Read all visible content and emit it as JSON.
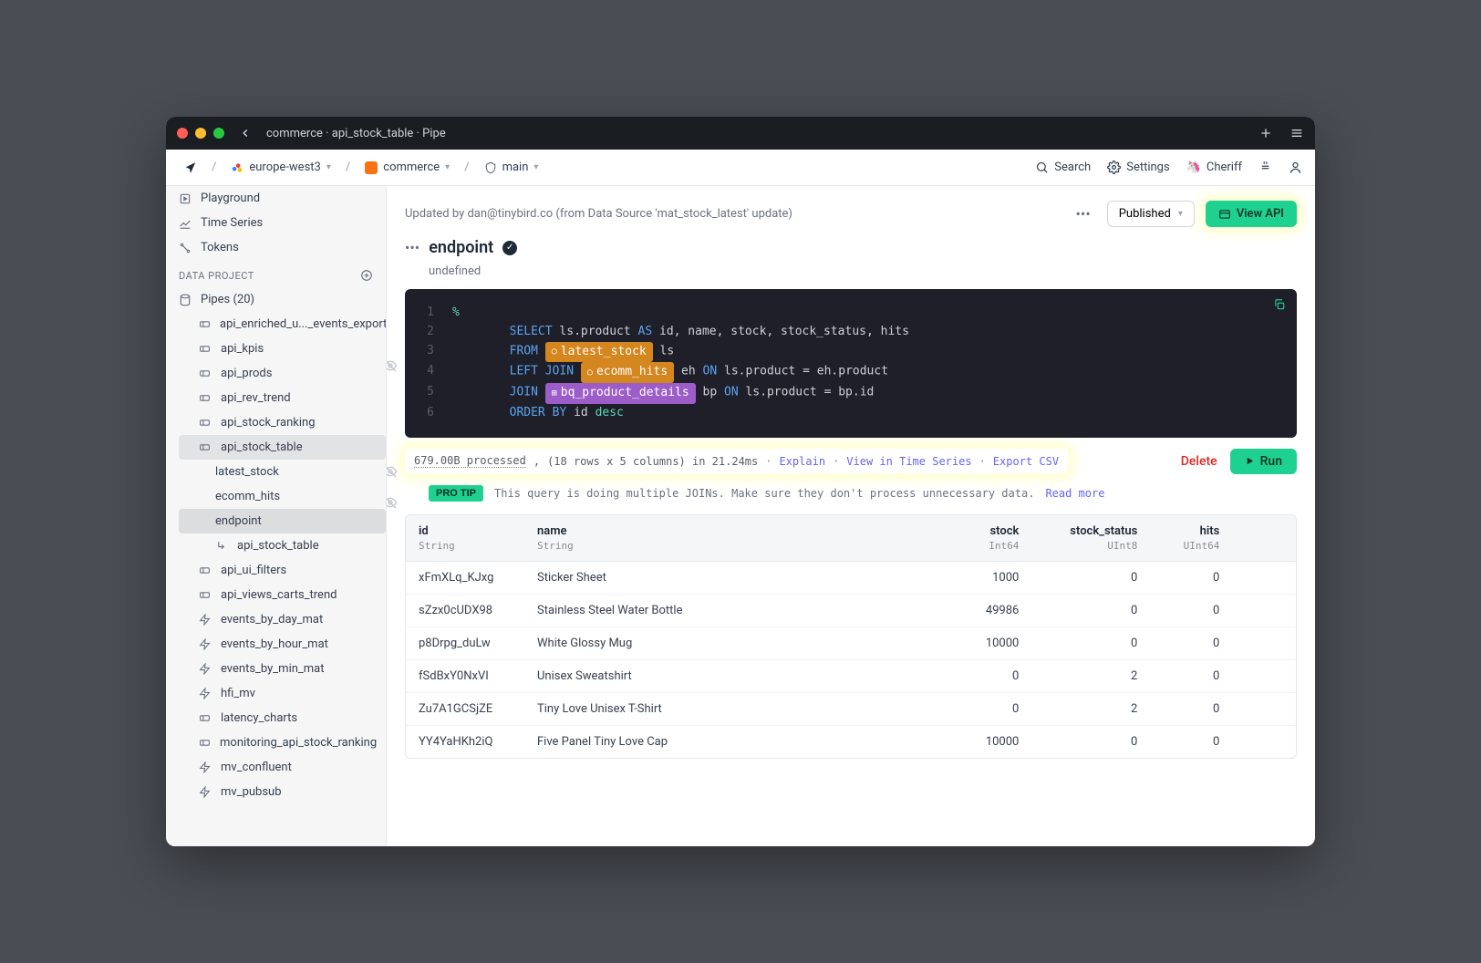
{
  "titlebar": {
    "title": "commerce · api_stock_table · Pipe"
  },
  "toolbar": {
    "region": "europe-west3",
    "workspace": "commerce",
    "branch": "main",
    "search": "Search",
    "settings": "Settings",
    "user": "Cheriff"
  },
  "sidebar": {
    "top": [
      {
        "icon": "play",
        "label": "Playground"
      },
      {
        "icon": "chart",
        "label": "Time Series"
      },
      {
        "icon": "token",
        "label": "Tokens"
      }
    ],
    "section_label": "DATA PROJECT",
    "pipes_label": "Pipes (20)",
    "pipes": [
      {
        "icon": "pipe",
        "label": "api_enriched_u..._events_export"
      },
      {
        "icon": "pipe",
        "label": "api_kpis"
      },
      {
        "icon": "pipe",
        "label": "api_prods"
      },
      {
        "icon": "pipe",
        "label": "api_rev_trend"
      },
      {
        "icon": "pipe",
        "label": "api_stock_ranking"
      },
      {
        "icon": "pipe",
        "label": "api_stock_table",
        "active": true,
        "children": [
          {
            "label": "latest_stock"
          },
          {
            "label": "ecomm_hits"
          },
          {
            "label": "endpoint",
            "selected": true
          },
          {
            "label": "api_stock_table",
            "arrow": true
          }
        ]
      },
      {
        "icon": "pipe",
        "label": "api_ui_filters"
      },
      {
        "icon": "pipe",
        "label": "api_views_carts_trend"
      },
      {
        "icon": "bolt",
        "label": "events_by_day_mat"
      },
      {
        "icon": "bolt",
        "label": "events_by_hour_mat"
      },
      {
        "icon": "bolt",
        "label": "events_by_min_mat"
      },
      {
        "icon": "bolt",
        "label": "hfi_mv"
      },
      {
        "icon": "pipe",
        "label": "latency_charts"
      },
      {
        "icon": "pipe",
        "label": "monitoring_api_stock_ranking"
      },
      {
        "icon": "bolt",
        "label": "mv_confluent"
      },
      {
        "icon": "bolt",
        "label": "mv_pubsub"
      }
    ]
  },
  "header": {
    "updated": "Updated by dan@tinybird.co (from Data Source 'mat_stock_latest' update)",
    "published": "Published",
    "view_api": "View API"
  },
  "node": {
    "title": "endpoint",
    "subtitle": "undefined"
  },
  "code": {
    "lines": [
      {
        "n": "1",
        "tokens": [
          {
            "t": "%",
            "c": "cyan"
          }
        ]
      },
      {
        "n": "2",
        "tokens": [
          {
            "t": "        ",
            "c": "text"
          },
          {
            "t": "SELECT",
            "c": "blue"
          },
          {
            "t": " ls.product ",
            "c": "text"
          },
          {
            "t": "AS",
            "c": "blue"
          },
          {
            "t": " id, name, stock, stock_status, hits",
            "c": "text"
          }
        ]
      },
      {
        "n": "3",
        "tokens": [
          {
            "t": "        ",
            "c": "text"
          },
          {
            "t": "FROM",
            "c": "blue"
          },
          {
            "t": " ",
            "c": "text"
          },
          {
            "t": "latest_stock",
            "c": "orange-chip"
          },
          {
            "t": " ls",
            "c": "text"
          }
        ]
      },
      {
        "n": "4",
        "tokens": [
          {
            "t": "        ",
            "c": "text"
          },
          {
            "t": "LEFT",
            "c": "blue"
          },
          {
            "t": " ",
            "c": "text"
          },
          {
            "t": "JOIN",
            "c": "blue"
          },
          {
            "t": " ",
            "c": "text"
          },
          {
            "t": "ecomm_hits",
            "c": "orange-chip"
          },
          {
            "t": " eh ",
            "c": "text"
          },
          {
            "t": "ON",
            "c": "blue"
          },
          {
            "t": " ls.product = eh.product",
            "c": "text"
          }
        ]
      },
      {
        "n": "5",
        "tokens": [
          {
            "t": "        ",
            "c": "text"
          },
          {
            "t": "JOIN",
            "c": "blue"
          },
          {
            "t": " ",
            "c": "text"
          },
          {
            "t": "bq_product_details",
            "c": "purple-chip"
          },
          {
            "t": " bp ",
            "c": "text"
          },
          {
            "t": "ON",
            "c": "blue"
          },
          {
            "t": " ls.product = bp.id",
            "c": "text"
          }
        ]
      },
      {
        "n": "6",
        "tokens": [
          {
            "t": "        ",
            "c": "text"
          },
          {
            "t": "ORDER",
            "c": "blue"
          },
          {
            "t": " ",
            "c": "text"
          },
          {
            "t": "BY",
            "c": "blue"
          },
          {
            "t": " id ",
            "c": "text"
          },
          {
            "t": "desc",
            "c": "cyan"
          }
        ]
      }
    ]
  },
  "results": {
    "processed": "679.00B processed",
    "shape": "(18 rows x 5 columns) in 21.24ms",
    "explain": "Explain",
    "timeseries": "View in Time Series",
    "export": "Export CSV",
    "delete": "Delete",
    "run": "Run"
  },
  "protip": {
    "badge": "PRO TIP",
    "text": "This query is doing multiple JOINs. Make sure they don't process unnecessary data.",
    "link": "Read more"
  },
  "table": {
    "columns": [
      {
        "name": "id",
        "type": "String",
        "align": "left"
      },
      {
        "name": "name",
        "type": "String",
        "align": "left"
      },
      {
        "name": "stock",
        "type": "Int64",
        "align": "right"
      },
      {
        "name": "stock_status",
        "type": "UInt8",
        "align": "right"
      },
      {
        "name": "hits",
        "type": "UInt64",
        "align": "right"
      }
    ],
    "rows": [
      [
        "xFmXLq_KJxg",
        "Sticker Sheet",
        "1000",
        "0",
        "0"
      ],
      [
        "sZzx0cUDX98",
        "Stainless Steel Water Bottle",
        "49986",
        "0",
        "0"
      ],
      [
        "p8Drpg_duLw",
        "White Glossy Mug",
        "10000",
        "0",
        "0"
      ],
      [
        "fSdBxY0NxVI",
        "Unisex Sweatshirt",
        "0",
        "2",
        "0"
      ],
      [
        "Zu7A1GCSjZE",
        "Tiny Love Unisex T-Shirt",
        "0",
        "2",
        "0"
      ],
      [
        "YY4YaHKh2iQ",
        "Five Panel Tiny Love Cap",
        "10000",
        "0",
        "0"
      ]
    ]
  }
}
